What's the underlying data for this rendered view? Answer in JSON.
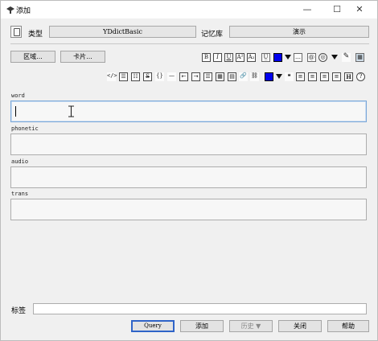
{
  "window": {
    "title": "添加",
    "min_glyph": "—",
    "max_glyph": "☐",
    "close_glyph": "✕"
  },
  "deck_row": {
    "type_label": "类型",
    "type_value": "YDdictBasic",
    "deck_label": "记忆库",
    "deck_value": "演示"
  },
  "editor_buttons": {
    "fields": "区域...",
    "cards": "卡片..."
  },
  "toolbar_row1": [
    "B",
    "I",
    "U",
    "A²",
    "A₂",
    "U̲",
    "",
    "",
    "…",
    "@",
    "◎",
    "",
    "✎",
    "▦"
  ],
  "toolbar_row2": [
    "</>",
    "☰",
    "☷",
    "S",
    "{}",
    "—",
    "⇤",
    "⇥",
    "☰",
    "▦",
    "▤",
    "🔗",
    "⛓",
    "",
    "",
    "❝",
    "≡",
    "≡",
    "≡",
    "≡",
    "H",
    "?"
  ],
  "fields": [
    {
      "name": "word",
      "value": ""
    },
    {
      "name": "phonetic",
      "value": ""
    },
    {
      "name": "audio",
      "value": ""
    },
    {
      "name": "trans",
      "value": ""
    }
  ],
  "tags": {
    "label": "标签",
    "value": ""
  },
  "bottom_buttons": {
    "query": "Query",
    "add": "添加",
    "history": "历史 ▼",
    "close": "关闭",
    "help": "帮助"
  },
  "colors": {
    "accent_blue": "#0000ee",
    "default_button_border": "#2f64c8",
    "focus_border": "#7aa7d8"
  }
}
